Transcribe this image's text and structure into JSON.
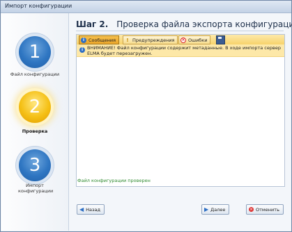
{
  "window": {
    "title": "Импорт конфигурации"
  },
  "steps": [
    {
      "number": "1",
      "label": "Файл конфигурации",
      "state": "inactive"
    },
    {
      "number": "2",
      "label": "Проверка",
      "state": "active"
    },
    {
      "number": "3",
      "label": "Импорт конфигурации",
      "state": "inactive"
    }
  ],
  "step_heading": {
    "number": "Шаг 2.",
    "title": "Проверка файла экспорта конфигурации"
  },
  "filters": {
    "messages_label": "Сообщения",
    "warnings_label": "Предупреждения",
    "errors_label": "Ошибки"
  },
  "messages": [
    {
      "type": "info",
      "text": "ВНИМАНИЕ! Файл конфигурации содержит метаданные. В ходе импорта сервер ELMA будет перезагружен."
    }
  ],
  "status": {
    "text": "Файл конфигурации проверен"
  },
  "buttons": {
    "back": "Назад",
    "next": "Далее",
    "cancel": "Отменить"
  },
  "colors": {
    "accent": "#2f76c2",
    "active_step": "#f5c015",
    "status_ok": "#2e8a2e",
    "filter_bar": "#f7d36c"
  }
}
